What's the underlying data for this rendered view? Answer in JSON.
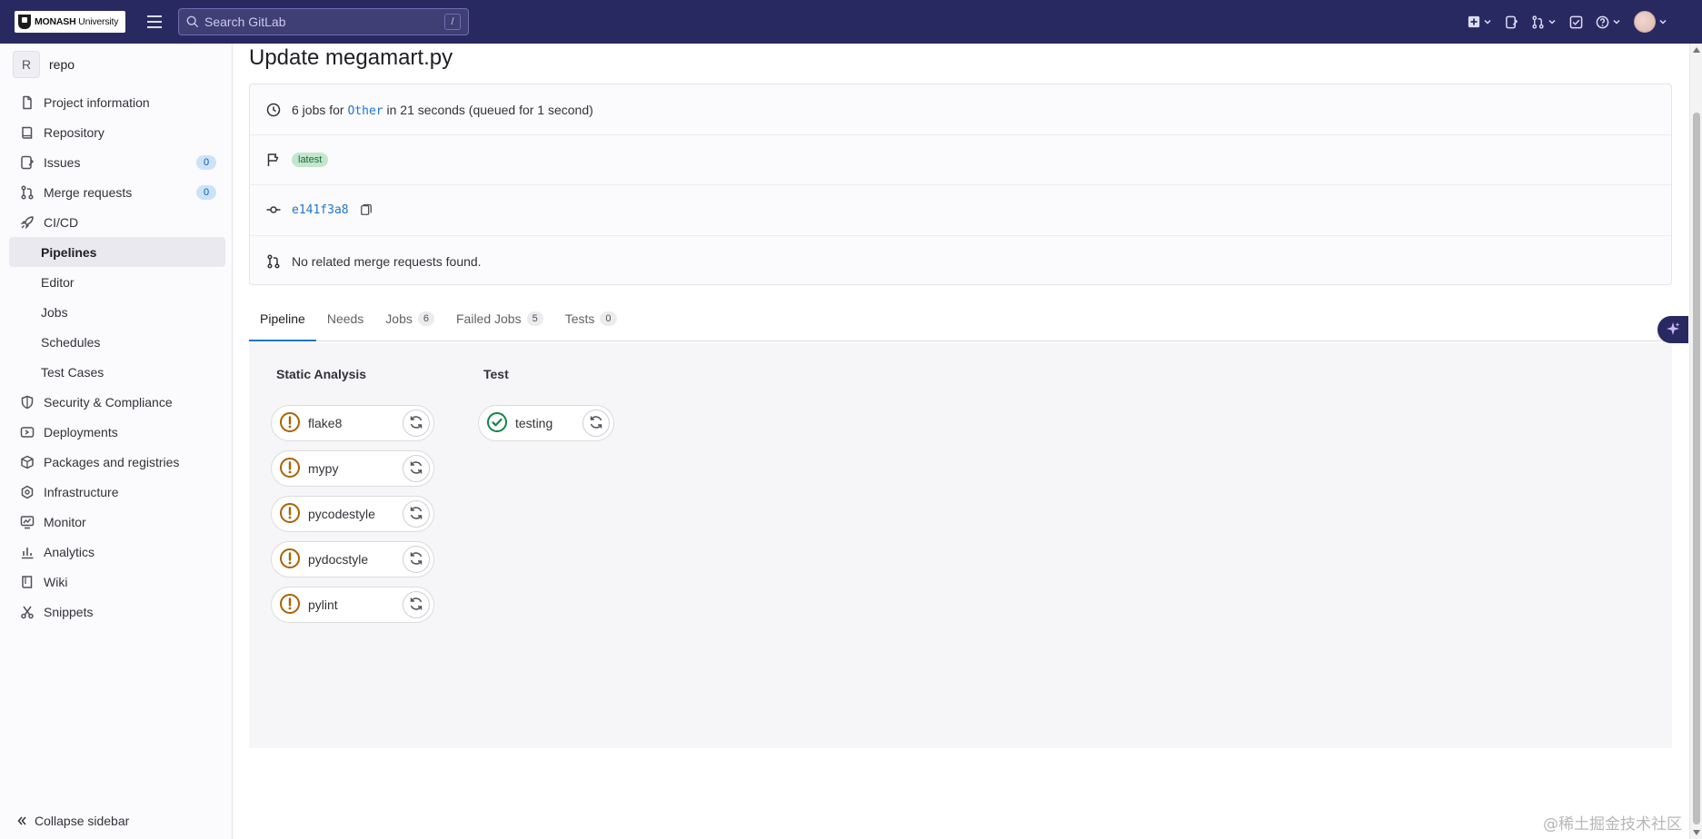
{
  "topbar": {
    "logo": {
      "bold": "MONASH",
      "light": " University"
    },
    "search": {
      "placeholder": "Search GitLab",
      "shortcut": "/"
    }
  },
  "sidebar": {
    "project": {
      "avatar": "R",
      "name": "repo"
    },
    "items": [
      {
        "label": "Project information",
        "icon": "project-info-icon"
      },
      {
        "label": "Repository",
        "icon": "repository-icon"
      },
      {
        "label": "Issues",
        "icon": "issues-icon",
        "badge": "0"
      },
      {
        "label": "Merge requests",
        "icon": "merge-request-icon",
        "badge": "0"
      },
      {
        "label": "CI/CD",
        "icon": "rocket-icon"
      },
      {
        "label": "Pipelines",
        "sub": true,
        "active": true
      },
      {
        "label": "Editor",
        "sub": true
      },
      {
        "label": "Jobs",
        "sub": true
      },
      {
        "label": "Schedules",
        "sub": true
      },
      {
        "label": "Test Cases",
        "sub": true
      },
      {
        "label": "Security & Compliance",
        "icon": "shield-icon"
      },
      {
        "label": "Deployments",
        "icon": "deployments-icon"
      },
      {
        "label": "Packages and registries",
        "icon": "package-icon"
      },
      {
        "label": "Infrastructure",
        "icon": "infrastructure-icon"
      },
      {
        "label": "Monitor",
        "icon": "monitor-icon"
      },
      {
        "label": "Analytics",
        "icon": "analytics-icon"
      },
      {
        "label": "Wiki",
        "icon": "book-icon"
      },
      {
        "label": "Snippets",
        "icon": "scissors-icon"
      }
    ],
    "collapse_label": "Collapse sidebar"
  },
  "page": {
    "title": "Update megamart.py",
    "summary": {
      "prefix": "6 jobs for ",
      "ref": "Other",
      "suffix": " in 21 seconds (queued for 1 second)"
    },
    "badge": "latest",
    "commit_sha": "e141f3a8",
    "merge_requests_text": "No related merge requests found."
  },
  "tabs": [
    {
      "label": "Pipeline",
      "active": true
    },
    {
      "label": "Needs"
    },
    {
      "label": "Jobs",
      "count": "6"
    },
    {
      "label": "Failed Jobs",
      "count": "5"
    },
    {
      "label": "Tests",
      "count": "0"
    }
  ],
  "stages": [
    {
      "title": "Static Analysis",
      "jobs": [
        {
          "name": "flake8",
          "status": "failed-allowed"
        },
        {
          "name": "mypy",
          "status": "failed-allowed"
        },
        {
          "name": "pycodestyle",
          "status": "failed-allowed"
        },
        {
          "name": "pydocstyle",
          "status": "failed-allowed"
        },
        {
          "name": "pylint",
          "status": "failed-allowed"
        }
      ]
    },
    {
      "title": "Test",
      "jobs": [
        {
          "name": "testing",
          "status": "passed"
        }
      ]
    }
  ],
  "colors": {
    "navbar": "#292961",
    "warning": "#ab6100",
    "success": "#108548",
    "link": "#1f75cb"
  },
  "watermark": "@稀土掘金技术社区"
}
